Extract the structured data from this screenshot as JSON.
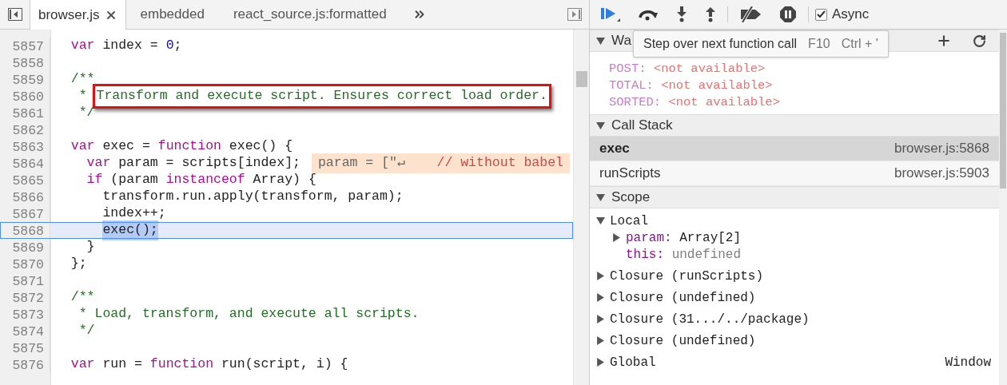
{
  "editor": {
    "tabs": [
      {
        "label": "browser.js",
        "selected": true
      },
      {
        "label": "embedded",
        "selected": false
      },
      {
        "label": "react_source.js:formatted",
        "selected": false
      }
    ],
    "lines": [
      {
        "number": "5857",
        "current": false,
        "tokens": [
          {
            "kind": "keyword",
            "text": "  var"
          },
          {
            "kind": "plain",
            "text": " index = "
          },
          {
            "kind": "number",
            "text": "0"
          },
          {
            "kind": "plain",
            "text": ";"
          }
        ]
      },
      {
        "number": "5858",
        "current": false
      },
      {
        "number": "5859",
        "current": false,
        "tokens": [
          {
            "kind": "comment",
            "text": "  /**"
          }
        ]
      },
      {
        "number": "5860",
        "current": false,
        "tokens": [
          {
            "kind": "comment",
            "text": "   * "
          },
          {
            "kind": "comment",
            "text": "Transform and execute script. Ensures correct load order.",
            "boxed": true
          }
        ]
      },
      {
        "number": "5861",
        "current": false,
        "tokens": [
          {
            "kind": "comment",
            "text": "   */"
          }
        ]
      },
      {
        "number": "5862",
        "current": false
      },
      {
        "number": "5863",
        "current": false,
        "tokens": [
          {
            "kind": "keyword",
            "text": "  var"
          },
          {
            "kind": "plain",
            "text": " exec = "
          },
          {
            "kind": "keyword",
            "text": "function"
          },
          {
            "kind": "plain",
            "text": " exec() {"
          }
        ]
      },
      {
        "number": "5864",
        "current": false,
        "tokens": [
          {
            "kind": "keyword",
            "text": "    var"
          },
          {
            "kind": "plain",
            "text": " param = scripts[index];"
          }
        ],
        "inline_value": {
          "name": "param = [\"↵",
          "rest": "    // without babel"
        }
      },
      {
        "number": "5865",
        "current": false,
        "tokens": [
          {
            "kind": "keyword",
            "text": "    if"
          },
          {
            "kind": "plain",
            "text": " (param "
          },
          {
            "kind": "keyword",
            "text": "instanceof"
          },
          {
            "kind": "plain",
            "text": " Array) {"
          }
        ]
      },
      {
        "number": "5866",
        "current": false,
        "tokens": [
          {
            "kind": "plain",
            "text": "      transform.run.apply(transform, param);"
          }
        ]
      },
      {
        "number": "5867",
        "current": false,
        "tokens": [
          {
            "kind": "plain",
            "text": "      index++;"
          }
        ]
      },
      {
        "number": "5868",
        "current": true,
        "tokens": [
          {
            "kind": "plain",
            "text": "      exec();",
            "selected": true
          }
        ]
      },
      {
        "number": "5869",
        "current": false,
        "tokens": [
          {
            "kind": "plain",
            "text": "    }"
          }
        ]
      },
      {
        "number": "5870",
        "current": false,
        "tokens": [
          {
            "kind": "plain",
            "text": "  };"
          }
        ]
      },
      {
        "number": "5871",
        "current": false
      },
      {
        "number": "5872",
        "current": false,
        "tokens": [
          {
            "kind": "comment",
            "text": "  /**"
          }
        ]
      },
      {
        "number": "5873",
        "current": false,
        "tokens": [
          {
            "kind": "comment",
            "text": "   * Load, transform, and execute all scripts."
          }
        ]
      },
      {
        "number": "5874",
        "current": false,
        "tokens": [
          {
            "kind": "comment",
            "text": "   */"
          }
        ]
      },
      {
        "number": "5875",
        "current": false
      },
      {
        "number": "5876",
        "current": false,
        "tokens": [
          {
            "kind": "keyword",
            "text": "  var"
          },
          {
            "kind": "plain",
            "text": " run = "
          },
          {
            "kind": "keyword",
            "text": "function"
          },
          {
            "kind": "plain",
            "text": " run(script, i) {"
          }
        ]
      }
    ]
  },
  "debugger": {
    "async": {
      "label": "Async",
      "checked": true
    },
    "tooltip": {
      "text": "Step over next function call",
      "shortcuts": [
        "F10",
        "Ctrl + '"
      ]
    },
    "watch": {
      "title": "Wa",
      "expanded": true,
      "items": [
        {
          "name": "POST:",
          "value": "<not available>"
        },
        {
          "name": "TOTAL:",
          "value": "<not available>"
        },
        {
          "name": "SORTED:",
          "value": "<not available>"
        }
      ]
    },
    "call_stack": {
      "title": "Call Stack",
      "expanded": true,
      "frames": [
        {
          "function": "exec",
          "location": "browser.js:5868",
          "selected": true
        },
        {
          "function": "runScripts",
          "location": "browser.js:5903",
          "selected": false
        }
      ]
    },
    "scope": {
      "title": "Scope",
      "expanded": true,
      "items": [
        {
          "label": "Local",
          "expanded": true,
          "children": [
            {
              "name": "param:",
              "value": "Array[2]",
              "kind": "object",
              "expanded": false
            },
            {
              "name": "this:",
              "value": "undefined",
              "kind": "undefined"
            }
          ]
        },
        {
          "label": "Closure (runScripts)",
          "expanded": false
        },
        {
          "label": "Closure (undefined)",
          "expanded": false
        },
        {
          "label": "Closure (31.../../package)",
          "expanded": false
        },
        {
          "label": "Closure (undefined)",
          "expanded": false
        },
        {
          "label": "Global",
          "value": "Window",
          "expanded": false
        }
      ]
    }
  }
}
